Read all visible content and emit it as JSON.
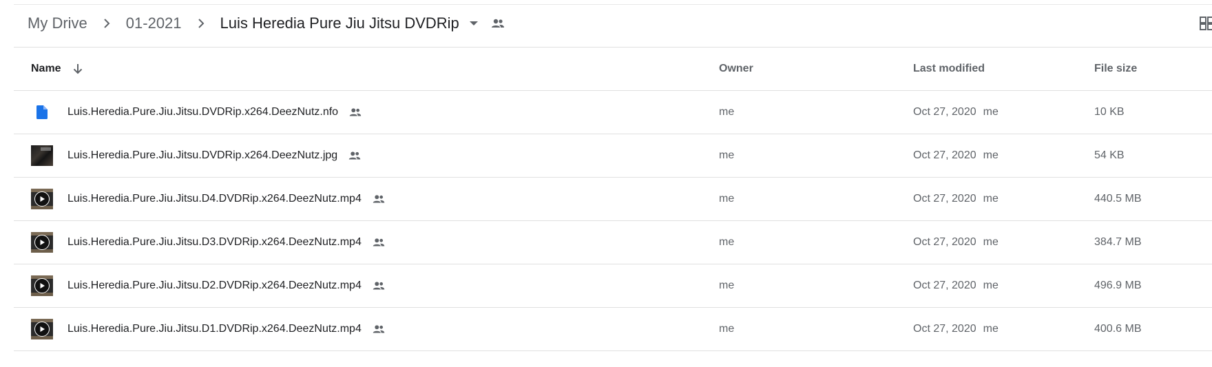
{
  "breadcrumb": {
    "items": [
      {
        "label": "My Drive"
      },
      {
        "label": "01-2021"
      },
      {
        "label": "Luis Heredia Pure Jiu Jitsu DVDRip"
      }
    ]
  },
  "columns": {
    "name": "Name",
    "owner": "Owner",
    "last_modified": "Last modified",
    "file_size": "File size"
  },
  "files": [
    {
      "name": "Luis.Heredia.Pure.Jiu.Jitsu.DVDRip.x264.DeezNutz.nfo",
      "owner": "me",
      "modified": "Oct 27, 2020",
      "modified_by": "me",
      "size": "10 KB",
      "icon": "document-icon"
    },
    {
      "name": "Luis.Heredia.Pure.Jiu.Jitsu.DVDRip.x264.DeezNutz.jpg",
      "owner": "me",
      "modified": "Oct 27, 2020",
      "modified_by": "me",
      "size": "54 KB",
      "icon": "image-thumbnail"
    },
    {
      "name": "Luis.Heredia.Pure.Jiu.Jitsu.D4.DVDRip.x264.DeezNutz.mp4",
      "owner": "me",
      "modified": "Oct 27, 2020",
      "modified_by": "me",
      "size": "440.5 MB",
      "icon": "video-thumbnail"
    },
    {
      "name": "Luis.Heredia.Pure.Jiu.Jitsu.D3.DVDRip.x264.DeezNutz.mp4",
      "owner": "me",
      "modified": "Oct 27, 2020",
      "modified_by": "me",
      "size": "384.7 MB",
      "icon": "video-thumbnail"
    },
    {
      "name": "Luis.Heredia.Pure.Jiu.Jitsu.D2.DVDRip.x264.DeezNutz.mp4",
      "owner": "me",
      "modified": "Oct 27, 2020",
      "modified_by": "me",
      "size": "496.9 MB",
      "icon": "video-thumbnail"
    },
    {
      "name": "Luis.Heredia.Pure.Jiu.Jitsu.D1.DVDRip.x264.DeezNutz.mp4",
      "owner": "me",
      "modified": "Oct 27, 2020",
      "modified_by": "me",
      "size": "400.6 MB",
      "icon": "video-thumbnail"
    }
  ],
  "icons": {
    "breadcrumb_separator": "chevron-right-icon",
    "folder_menu": "caret-down-icon",
    "shared": "people-icon",
    "sort": "arrow-down-icon",
    "view_toggle": "grid-view-icon"
  },
  "colors": {
    "doc_icon": "#1a73e8",
    "divider": "#e0e0e0",
    "text_primary": "#202124",
    "text_secondary": "#5f6368"
  }
}
